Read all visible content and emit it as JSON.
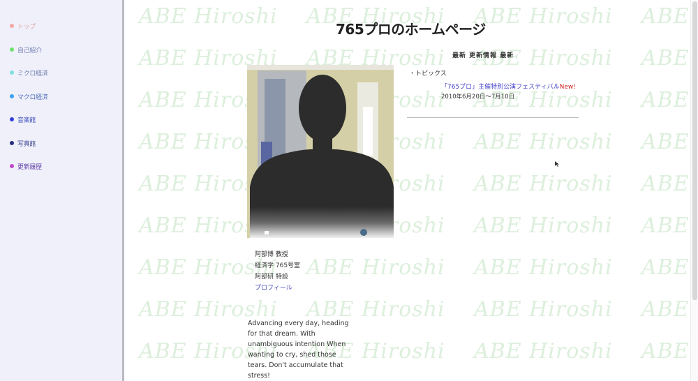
{
  "nav": {
    "items": [
      {
        "label": "トップ",
        "dot_color": "#f3a6a6",
        "text_color": "#e4a0a0"
      },
      {
        "label": "自己紹介",
        "dot_color": "#6ee06e",
        "text_color": "#7080b0"
      },
      {
        "label": "ミクロ経済",
        "dot_color": "#7ee0e0",
        "text_color": "#7080b0"
      },
      {
        "label": "マクロ経済",
        "dot_color": "#3aa0f0",
        "text_color": "#5070b8"
      },
      {
        "label": "音楽館",
        "dot_color": "#2f3fd8",
        "text_color": "#4050b8"
      },
      {
        "label": "写真館",
        "dot_color": "#27307e",
        "text_color": "#404a90"
      },
      {
        "label": "更新履歴",
        "dot_color": "#c04ac8",
        "text_color": "#6040a8"
      }
    ]
  },
  "watermark": {
    "text": "ABE Hiroshi",
    "color": "#dcefdc"
  },
  "page": {
    "title": "765プロのホームページ"
  },
  "profile": {
    "lines": [
      "阿部博 教授",
      "経済学 765号室",
      "阿部研 特設"
    ],
    "link_label": "プロフィール"
  },
  "quote": {
    "text": "Advancing every day, heading for that dream. With unambiguous intention When wanting to cry, shed those tears. Don't accumulate that stress!"
  },
  "updates": {
    "header": "最新 更新情報 最新",
    "topics_label": "・トピックス",
    "news_title": "「765プロ」主催特別公演フェスティバル",
    "news_badge": "New!",
    "news_date": "2010年6月20日～7月10日"
  }
}
